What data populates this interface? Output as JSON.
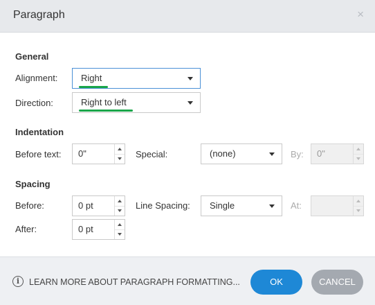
{
  "dialog": {
    "title": "Paragraph",
    "close_glyph": "×"
  },
  "general": {
    "heading": "General",
    "alignment_label": "Alignment:",
    "alignment_value": "Right",
    "direction_label": "Direction:",
    "direction_value": "Right to left"
  },
  "indentation": {
    "heading": "Indentation",
    "before_text_label": "Before text:",
    "before_text_value": "0\"",
    "special_label": "Special:",
    "special_value": "(none)",
    "by_label": "By:",
    "by_value": "0\""
  },
  "spacing": {
    "heading": "Spacing",
    "before_label": "Before:",
    "before_value": "0 pt",
    "line_spacing_label": "Line Spacing:",
    "line_spacing_value": "Single",
    "at_label": "At:",
    "at_value": "",
    "after_label": "After:",
    "after_value": "0 pt"
  },
  "footer": {
    "info_glyph": "i",
    "learn_more": "LEARN MORE ABOUT PARAGRAPH FORMATTING...",
    "ok_label": "OK",
    "cancel_label": "CANCEL"
  },
  "colors": {
    "accent": "#1e88d6",
    "highlight_underline": "#1aa64a",
    "cancel_button": "#a4a9b0"
  },
  "icons": [
    "close-icon",
    "chevron-down-icon",
    "spinner-up-icon",
    "spinner-down-icon",
    "info-icon"
  ]
}
